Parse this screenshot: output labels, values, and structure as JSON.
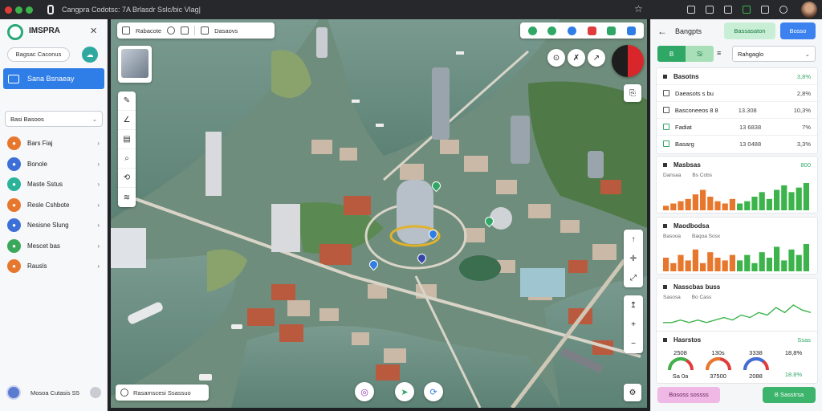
{
  "titlebar": {
    "title": "Cangpra Codotsc: 7A Brlasdr Sslc/bic Vlag|",
    "dot_colors": [
      "#e23b3b",
      "#3cb44b",
      "#3cb44b"
    ]
  },
  "sidebar": {
    "brand": "IMSPRA",
    "pill_label": "Bagsac Caconus",
    "active_item": "Sana Bsnaeay",
    "select_label": "Basi Basoos",
    "items": [
      {
        "label": "Bars Fiaj",
        "icon": "fire-icon",
        "color": "#e8772e"
      },
      {
        "label": "Bonole",
        "icon": "globe-icon",
        "color": "#3d6fd8"
      },
      {
        "label": "Maste Sstus",
        "icon": "water-icon",
        "color": "#2bb39a"
      },
      {
        "label": "Resle Cshbote",
        "icon": "road-icon",
        "color": "#e8772e"
      },
      {
        "label": "Nesisne Slung",
        "icon": "layers-icon",
        "color": "#3d6fd8"
      },
      {
        "label": "Mescet bas",
        "icon": "leaf-icon",
        "color": "#3aa85a"
      },
      {
        "label": "Rausls",
        "icon": "alert-icon",
        "color": "#e8772e"
      }
    ],
    "footer_label": "Mosoa Cutasis S5"
  },
  "map": {
    "search_label": "Rabacote",
    "search_mode": "Dasaovs",
    "status_text": "Rasamscesi Ssassuo",
    "tab_colors": [
      "#2fa866",
      "#2fa866",
      "#2f7de6",
      "#e23b3b",
      "#2fa866",
      "#2f7de6"
    ]
  },
  "right_panel": {
    "title": "Bangpts",
    "button_a": "Bassasaton",
    "button_b": "Bosso",
    "segment_left": "B",
    "segment_right": "Si",
    "dropdown": "Rahgaglo",
    "summary": {
      "title": "Basotns",
      "value": "3,8%",
      "rows": [
        {
          "label": "Daeasots s bu",
          "mid": "",
          "value": "2,8%"
        },
        {
          "label": "Basconeeos 8 8",
          "mid": "13.308",
          "value": "10,3%"
        },
        {
          "label": "Fadiat",
          "mid": "13 6838",
          "value": "7%"
        },
        {
          "label": "Basarg",
          "mid": "13 0488",
          "value": "3,3%"
        }
      ]
    },
    "chart1": {
      "title": "Masbsas",
      "value": "800",
      "legend": "Dansaa",
      "legend2": "Bs Cobs"
    },
    "chart2": {
      "title": "Maodbodsa",
      "legend": "Basooa",
      "legend2": "Baqoa Sosx"
    },
    "chart3": {
      "title": "Nasscbas buss",
      "legend": "Sasosa",
      "legend2": "Bo Cass"
    },
    "health": {
      "title": "Hasrstos",
      "value": "Ssas",
      "gauges": [
        {
          "top": "2508",
          "bottom": "Sa 0a",
          "value": 0.68,
          "color": "#3cb44b"
        },
        {
          "top": "130s",
          "bottom": "37500",
          "value": 0.55,
          "color": "#e8772e"
        },
        {
          "top": "3338",
          "bottom": "2088",
          "value": 0.72,
          "color": "#3d6fd8"
        },
        {
          "top": "18,8%",
          "bottom": "18.8%",
          "value": null,
          "color": "#3cb44b"
        }
      ]
    },
    "footer_a": "Bososs sossss",
    "footer_b": "B Sasstrsa"
  },
  "chart_data": [
    {
      "type": "bar",
      "title": "Masbsas",
      "series": [
        {
          "name": "Dansaa",
          "values": [
            2,
            3,
            4,
            5,
            7,
            9,
            6,
            4,
            3,
            5
          ]
        },
        {
          "name": "Bs Cobs",
          "values": [
            3,
            4,
            6,
            8,
            5,
            9,
            11,
            8,
            10,
            12
          ]
        }
      ]
    },
    {
      "type": "bar",
      "title": "Maodbodsa",
      "series": [
        {
          "name": "Basooa",
          "values": [
            5,
            3,
            6,
            4,
            8,
            3,
            7,
            5,
            4,
            6
          ]
        },
        {
          "name": "Baqoa Sosx",
          "values": [
            4,
            6,
            3,
            7,
            5,
            9,
            4,
            8,
            6,
            10
          ]
        }
      ]
    },
    {
      "type": "line",
      "title": "Nasscbas buss",
      "series": [
        {
          "name": "Sasosa",
          "values": [
            2,
            2,
            3,
            2,
            3,
            2,
            3,
            4,
            3,
            5,
            4,
            6,
            5,
            8,
            6,
            9,
            7,
            6
          ]
        }
      ]
    }
  ]
}
